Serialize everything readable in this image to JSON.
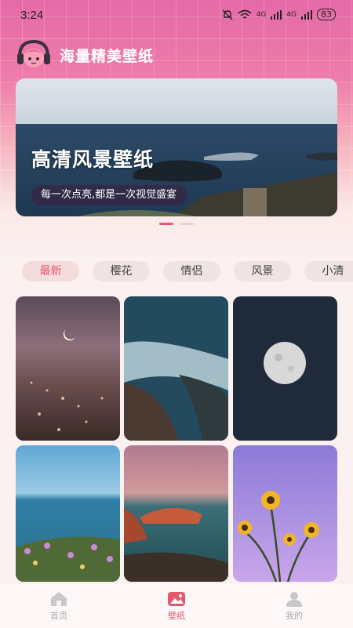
{
  "status_bar": {
    "time": "3:24",
    "battery": "83",
    "net1": "4G",
    "net2": "4G"
  },
  "app": {
    "title": "海量精美壁纸"
  },
  "banner": {
    "title": "高清风景壁纸",
    "subtitle": "每一次点亮,都是一次视觉盛宴",
    "slide_count": 2,
    "active_slide": 1
  },
  "categories": [
    {
      "label": "最新",
      "active": true
    },
    {
      "label": "樱花"
    },
    {
      "label": "情侣"
    },
    {
      "label": "风景"
    },
    {
      "label": "小清"
    }
  ],
  "tabs": [
    {
      "label": "首页",
      "icon": "home-icon"
    },
    {
      "label": "壁纸",
      "icon": "wallpaper-icon",
      "active": true
    },
    {
      "label": "我的",
      "icon": "user-icon"
    }
  ],
  "colors": {
    "accent": "#e3586b"
  }
}
